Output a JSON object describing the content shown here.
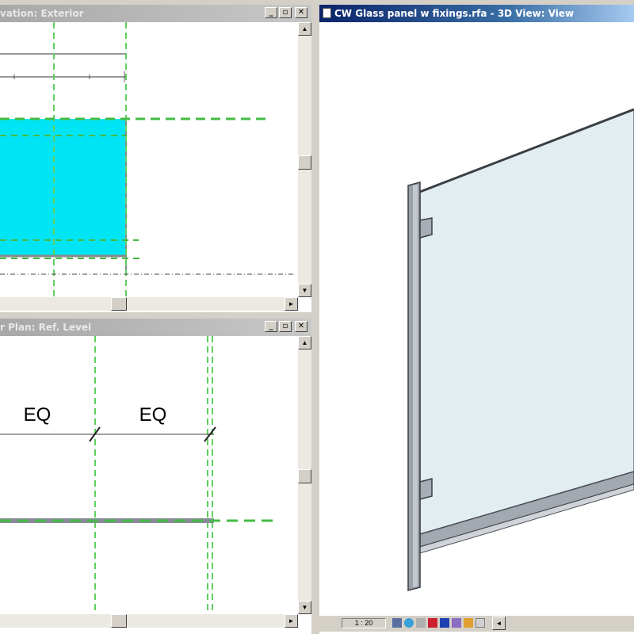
{
  "windows": {
    "elevation": {
      "title": "vation: Exterior"
    },
    "plan": {
      "title": "r Plan: Ref. Level",
      "dims": [
        "EQ",
        "EQ"
      ]
    },
    "view3d": {
      "title": "CW Glass panel w fixings.rfa - 3D View: View"
    }
  },
  "window_controls": {
    "minimize": "_",
    "restore": "▫",
    "close": "✕"
  },
  "status": {
    "scale": "1 : 20"
  },
  "colors": {
    "glass_fill": "#00e5f5",
    "ref_plane": "#44bb44",
    "panel_3d": "#e2edf2",
    "mullion": "#9aa0a8",
    "title_active": "#0a246a"
  }
}
